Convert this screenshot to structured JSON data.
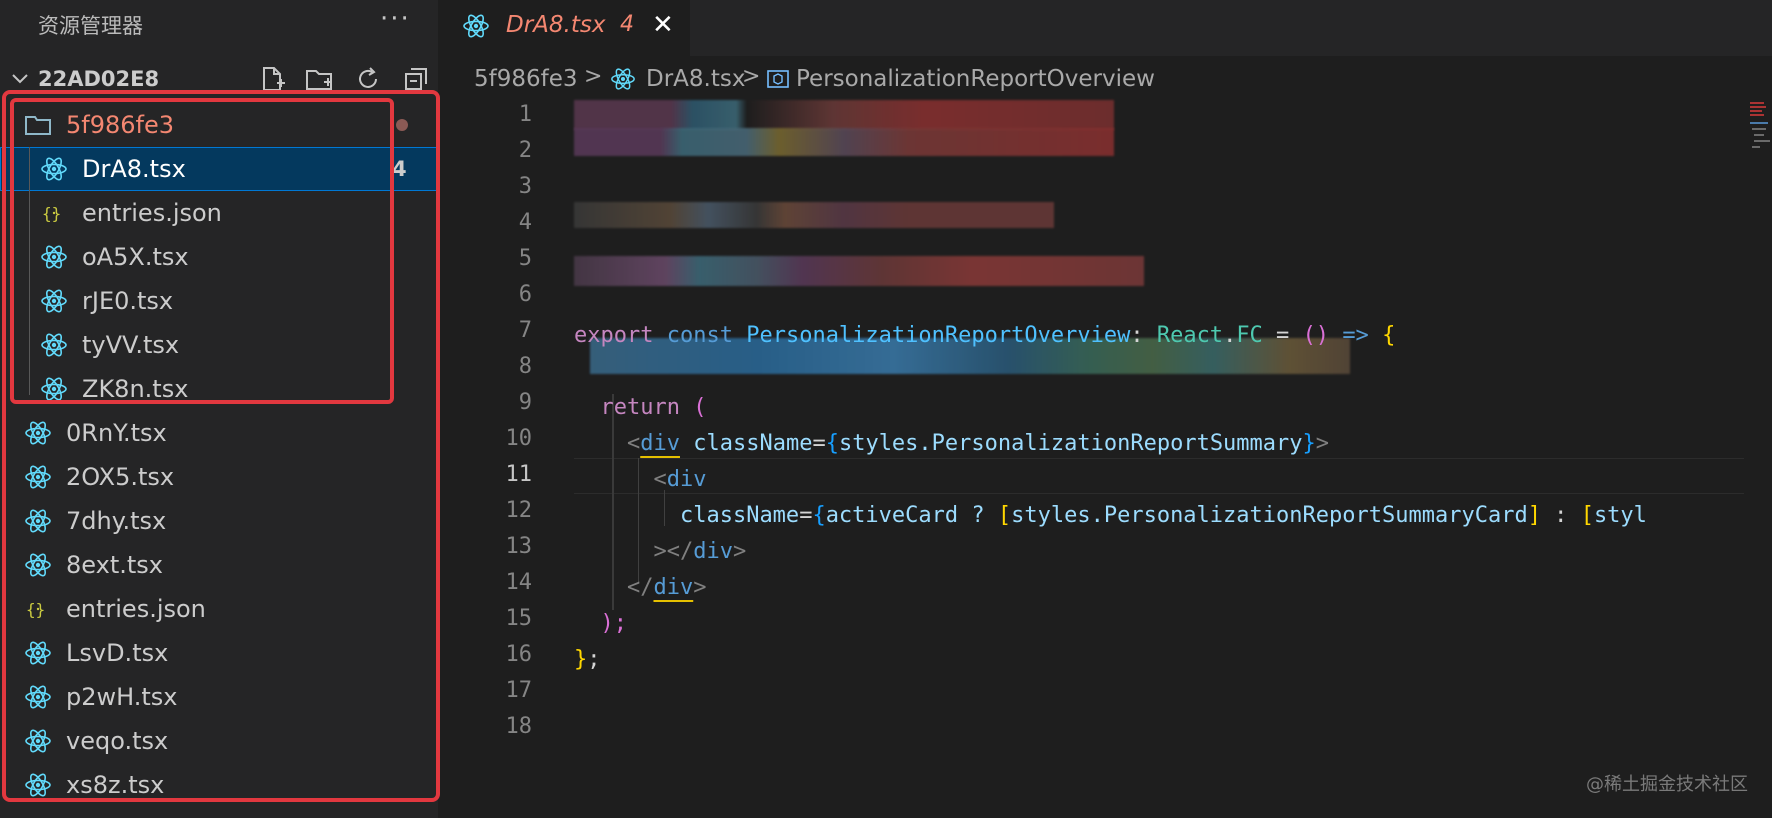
{
  "explorer": {
    "title": "资源管理器",
    "more": "···",
    "root": {
      "label": "22AD02E8"
    },
    "folder": {
      "name": "5f986fe3"
    },
    "folder_files": [
      {
        "name": "DrA8.tsx",
        "icon": "react-icon",
        "badge": "4",
        "selected": true
      },
      {
        "name": "entries.json",
        "icon": "json-icon"
      },
      {
        "name": "oA5X.tsx",
        "icon": "react-icon"
      },
      {
        "name": "rJE0.tsx",
        "icon": "react-icon"
      },
      {
        "name": "tyVV.tsx",
        "icon": "react-icon"
      },
      {
        "name": "ZK8n.tsx",
        "icon": "react-icon"
      }
    ],
    "root_files": [
      {
        "name": "0RnY.tsx",
        "icon": "react-icon"
      },
      {
        "name": "2OX5.tsx",
        "icon": "react-icon"
      },
      {
        "name": "7dhy.tsx",
        "icon": "react-icon"
      },
      {
        "name": "8ext.tsx",
        "icon": "react-icon"
      },
      {
        "name": "entries.json",
        "icon": "json-icon"
      },
      {
        "name": "LsvD.tsx",
        "icon": "react-icon"
      },
      {
        "name": "p2wH.tsx",
        "icon": "react-icon"
      },
      {
        "name": "veqo.tsx",
        "icon": "react-icon"
      },
      {
        "name": "xs8z.tsx",
        "icon": "react-icon"
      }
    ]
  },
  "tab": {
    "label": "DrA8.tsx",
    "badge": "4",
    "close": "✕"
  },
  "breadcrumb": {
    "folder": "5f986fe3",
    "file": "DrA8.tsx",
    "symbol": "PersonalizationReportOverview",
    "sep": ">"
  },
  "editor": {
    "line_numbers": [
      "1",
      "2",
      "3",
      "4",
      "5",
      "6",
      "7",
      "8",
      "9",
      "10",
      "11",
      "12",
      "13",
      "14",
      "15",
      "16",
      "17",
      "18"
    ],
    "active_line": "11",
    "code": {
      "l8_export": "export",
      "l8_const": "const",
      "l8_name": "PersonalizationReportOverview",
      "l8_colon": ":",
      "l8_react": "React",
      "l8_dot": ".",
      "l8_fc": "FC",
      "l8_eq": " = ",
      "l8_parens": "()",
      "l8_arrow": "=>",
      "l8_brace": "{",
      "l10_return": "return",
      "l10_paren": "(",
      "l11_lt": "<",
      "l11_div": "div",
      "l11_attr": "className",
      "l11_eq": "=",
      "l11_ob": "{",
      "l11_val": "styles.PersonalizationReportSummary",
      "l11_cb": "}",
      "l11_gt": ">",
      "l12_lt": "<",
      "l12_div": "div",
      "l13_attr": "className",
      "l13_eq": "=",
      "l13_ob": "{",
      "l13_val1": "activeCard ? ",
      "l13_ob2": "[",
      "l13_val2": "styles.PersonalizationReportSummaryCard",
      "l13_cb2": "]",
      "l13_val3": " : ",
      "l13_ob3": "[",
      "l13_val4": "styl",
      "l14_close": "></",
      "l14_div": "div",
      "l14_gt": ">",
      "l15_lt": "</",
      "l15_div": "div",
      "l15_gt": ">",
      "l16": ");",
      "l17_brace": "}",
      "l17_semi": ";"
    }
  },
  "watermark": "@稀土掘金技术社区",
  "colors": {
    "highlight": "#e2383f",
    "selection": "#04395e",
    "react": "#61dafb",
    "folder_text": "#f48771"
  }
}
